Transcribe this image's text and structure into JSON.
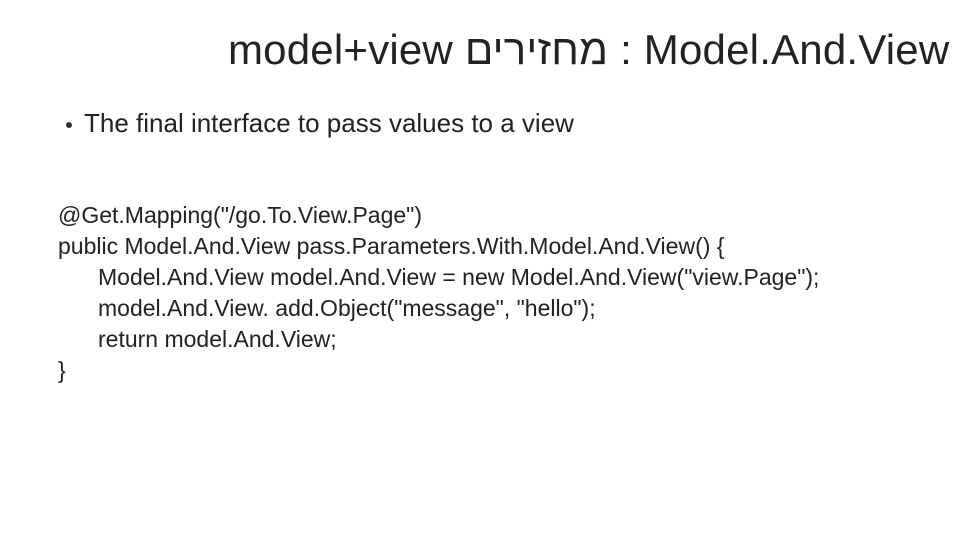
{
  "slide": {
    "title": "model+view מחזירים : Model.And.View",
    "bullet": "The final interface to pass values to a view",
    "code": {
      "l1": "@Get.Mapping(\"/go.To.View.Page\")",
      "l2": "public Model.And.View pass.Parameters.With.Model.And.View() {",
      "l3": "Model.And.View model.And.View = new Model.And.View(\"view.Page\");",
      "l4": "model.And.View. add.Object(\"message\", \"hello\");",
      "l5": "return model.And.View;",
      "l6": "}"
    }
  }
}
